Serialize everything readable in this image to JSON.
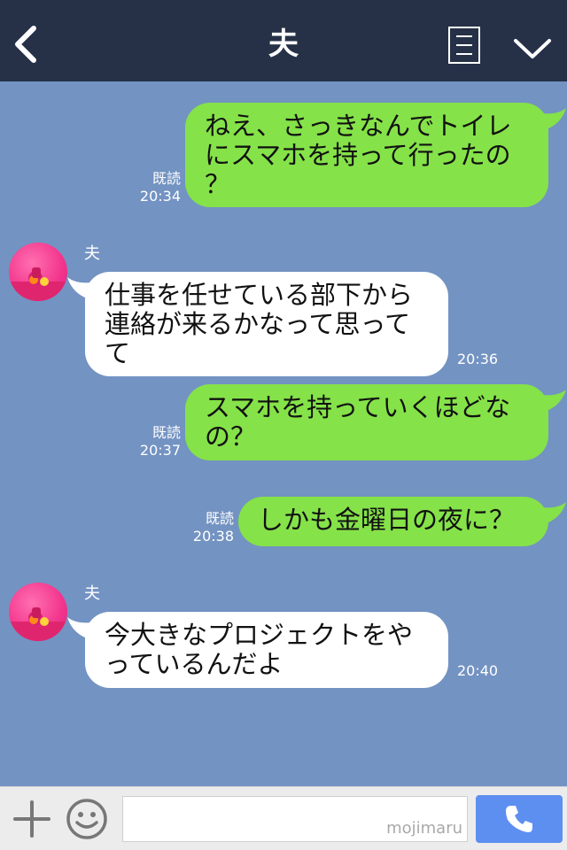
{
  "header": {
    "title": "夫"
  },
  "sender_name": "夫",
  "messages": [
    {
      "dir": "out",
      "lines": [
        "ねえ、さっきなんでトイレ",
        "にスマホを持って行ったの",
        "？"
      ],
      "read": "既読",
      "time": "20:34"
    },
    {
      "dir": "in",
      "lines": [
        "仕事を任せている部下から",
        "連絡が来るかなって思って",
        "て"
      ],
      "time": "20:36"
    },
    {
      "dir": "out",
      "lines": [
        "スマホを持っていくほどな",
        "の？"
      ],
      "read": "既読",
      "time": "20:37"
    },
    {
      "dir": "out",
      "lines": [
        "しかも金曜日の夜に？"
      ],
      "read": "既読",
      "time": "20:38"
    },
    {
      "dir": "in",
      "lines": [
        "今大きなプロジェクトをや",
        "っているんだよ"
      ],
      "time": "20:40"
    }
  ],
  "input": {
    "placeholder": "",
    "watermark": "mojimaru"
  },
  "icons": {
    "back": "back-arrow-icon",
    "menu": "menu-list-icon",
    "collapse": "chevron-down-icon",
    "plus": "plus-icon",
    "emoji": "emoji-icon",
    "call": "phone-icon"
  },
  "colors": {
    "background": "#7393c2",
    "header": "#263148",
    "outgoing_bubble": "#85e249",
    "incoming_bubble": "#ffffff",
    "call_button": "#5d8ff0"
  }
}
